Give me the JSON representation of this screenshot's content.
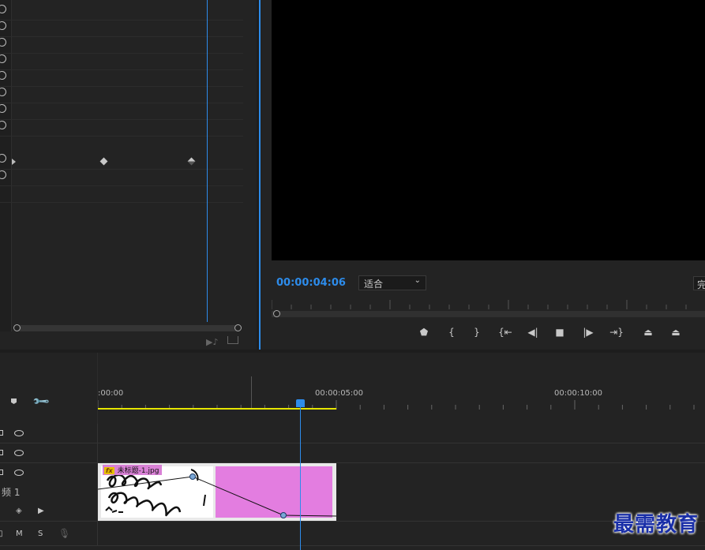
{
  "program_monitor": {
    "timecode": "00:00:04:06",
    "fit_label": "适合",
    "quality_label": "完"
  },
  "timeline": {
    "ruler_labels": [
      ":00:00",
      "00:00:05:00",
      "00:00:10:00"
    ],
    "clip_name": "未标题-1.jpg",
    "fx_badge": "fx",
    "track_label": "频 1",
    "audio_buttons": {
      "mute": "M",
      "solo": "S"
    }
  },
  "watermark": "最需教育",
  "icons": {
    "reset": "reset-icon",
    "eye": "eye-icon",
    "lock": "lock-icon",
    "wrench": "wrench-icon",
    "marker": "marker-icon",
    "mic": "mic-icon"
  },
  "colors": {
    "accent": "#2d8ceb",
    "work_area": "#e6e600",
    "clip_pink": "#e37de0"
  }
}
